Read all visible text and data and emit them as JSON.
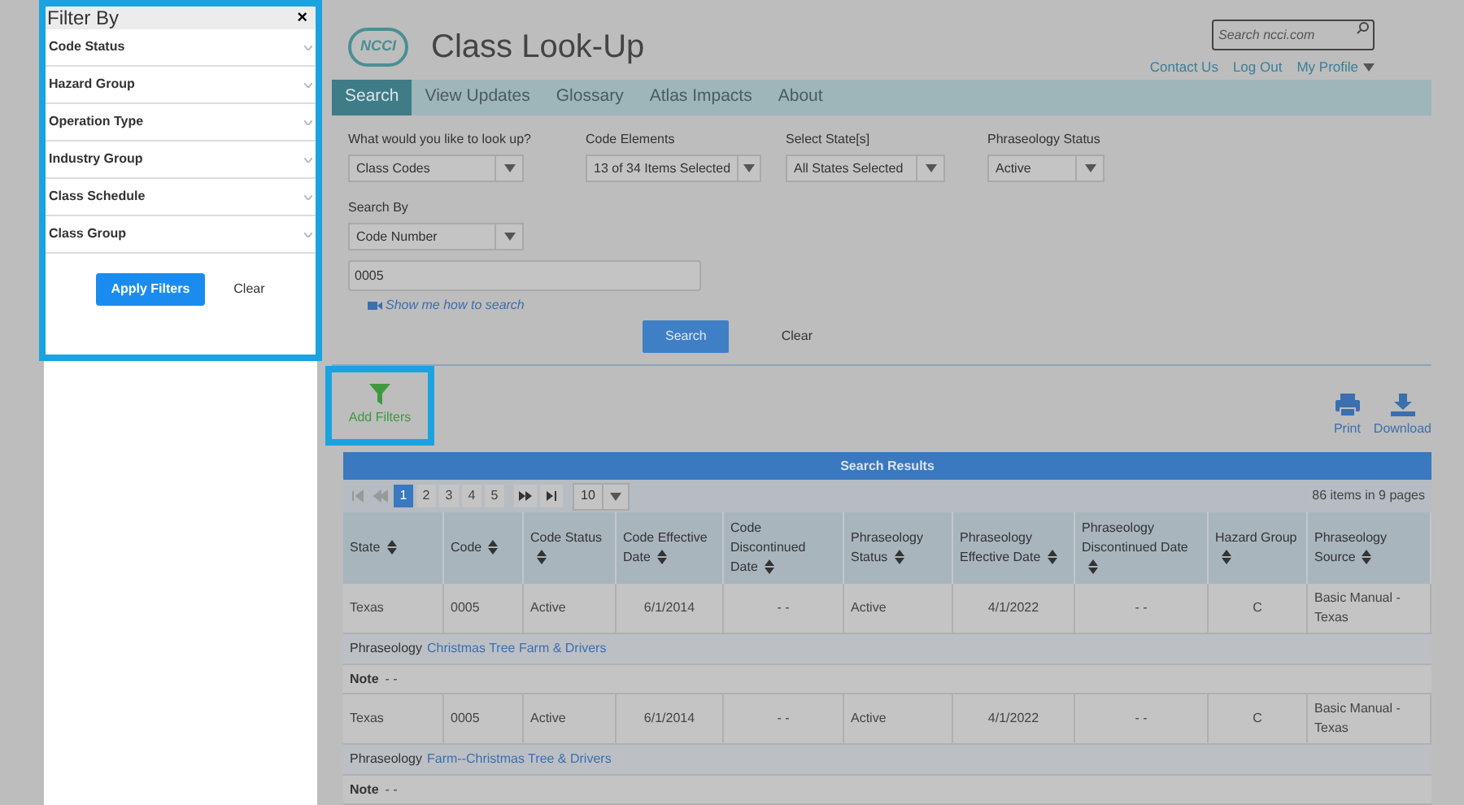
{
  "filter_panel": {
    "title": "Filter By",
    "close": "×",
    "items": [
      {
        "label": "Code Status"
      },
      {
        "label": "Hazard Group"
      },
      {
        "label": "Operation Type"
      },
      {
        "label": "Industry Group"
      },
      {
        "label": "Class Schedule"
      },
      {
        "label": "Class Group"
      }
    ],
    "apply": "Apply Filters",
    "clear": "Clear"
  },
  "header": {
    "logo_text": "NCCI",
    "title": "Class Look-Up",
    "search": {
      "placeholder": "Search ncci.com"
    },
    "links": [
      "Contact Us",
      "Log Out",
      "My Profile"
    ]
  },
  "tabs": [
    {
      "label": "Search",
      "selected": true
    },
    {
      "label": "View Updates",
      "selected": false
    },
    {
      "label": "Glossary",
      "selected": false
    },
    {
      "label": "Atlas Impacts",
      "selected": false
    },
    {
      "label": "About",
      "selected": false
    }
  ],
  "form": {
    "fields": [
      {
        "label": "What would you like to look up?",
        "value": "Class Codes"
      },
      {
        "label": "Code Elements",
        "value": "13 of 34 Items Selected"
      },
      {
        "label": "Select State[s]",
        "value": "All States Selected"
      },
      {
        "label": "Phraseology Status",
        "value": "Active"
      }
    ],
    "search_by": {
      "label": "Search By",
      "value": "Code Number"
    },
    "code": {
      "value": "0005"
    },
    "help_link": "Show me how to search",
    "search": "Search",
    "clear": "Clear"
  },
  "toolbar": {
    "add_filters": "Add Filters",
    "print": "Print",
    "download": "Download"
  },
  "results": {
    "title": "Search Results",
    "pages": [
      {
        "label": "1",
        "selected": true
      },
      {
        "label": "2",
        "selected": false
      },
      {
        "label": "3",
        "selected": false
      },
      {
        "label": "4",
        "selected": false
      },
      {
        "label": "5",
        "selected": false
      }
    ],
    "page_size": "10",
    "summary": "86 items in 9 pages",
    "columns": [
      "State",
      "Code",
      "Code Status",
      "Code Effective Date",
      "Code Discontinued Date",
      "Phraseology Status",
      "Phraseology Effective Date",
      "Phraseology Discontinued Date",
      "Hazard Group",
      "Phraseology Source"
    ],
    "rows": [
      {
        "cells": [
          "Texas",
          "0005",
          "Active",
          "6/1/2014",
          "- -",
          "Active",
          "4/1/2022",
          "- -",
          "C",
          "Basic Manual - Texas"
        ],
        "phraseology_label": "Phraseology",
        "phraseology": "Christmas Tree Farm & Drivers",
        "note_label": "Note",
        "note": "- -"
      },
      {
        "cells": [
          "Texas",
          "0005",
          "Active",
          "6/1/2014",
          "- -",
          "Active",
          "4/1/2022",
          "- -",
          "C",
          "Basic Manual - Texas"
        ],
        "phraseology_label": "Phraseology",
        "phraseology": "Farm--Christmas Tree & Drivers",
        "note_label": "Note",
        "note": "- -"
      }
    ]
  }
}
